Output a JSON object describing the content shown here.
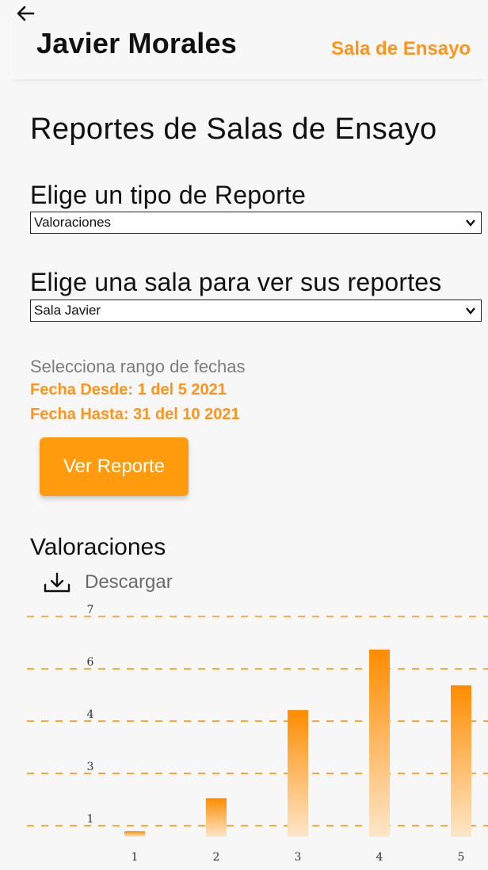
{
  "header": {
    "user_name": "Javier Morales",
    "nav_link": "Sala de Ensayo",
    "back_icon": "arrow-left-icon"
  },
  "page_title": "Reportes de Salas de Ensayo",
  "report_type": {
    "label": "Elige un tipo de Reporte",
    "selected": "Valoraciones"
  },
  "room": {
    "label": "Elige una sala para ver sus reportes",
    "selected": "Sala Javier"
  },
  "dates": {
    "hint": "Selecciona rango de fechas",
    "from": "Fecha Desde: 1 del 5 2021",
    "to": "Fecha Hasta: 31 del 10 2021"
  },
  "view_button": "Ver Reporte",
  "section_title": "Valoraciones",
  "download": {
    "icon": "download-icon",
    "label": "Descargar"
  },
  "colors": {
    "accent": "#ff9419",
    "button": "#ff9b0d",
    "bar_top": "#ff8c00",
    "bar_bottom": "#fde6c9"
  },
  "chart_data": {
    "type": "bar",
    "categories": [
      "1",
      "2",
      "3",
      "4",
      "5"
    ],
    "values": [
      1,
      2.2,
      5.4,
      7.6,
      6.3
    ],
    "yticks": [
      {
        "value": 1.2,
        "label": "1"
      },
      {
        "value": 3.1,
        "label": "3"
      },
      {
        "value": 5.0,
        "label": "4"
      },
      {
        "value": 6.9,
        "label": "6"
      },
      {
        "value": 8.8,
        "label": "7"
      }
    ],
    "ylim": [
      0.8,
      8.8
    ],
    "grid": true,
    "gridline_style": "dashed"
  }
}
